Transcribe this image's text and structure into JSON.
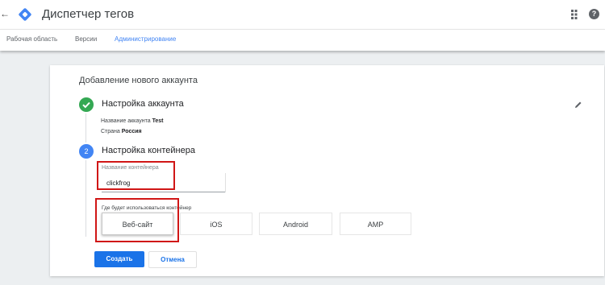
{
  "app": {
    "title": "Диспетчер тегов"
  },
  "nav": {
    "tabs": [
      {
        "label": "Рабочая область",
        "active": false
      },
      {
        "label": "Версии",
        "active": false
      },
      {
        "label": "Администрирование",
        "active": true
      }
    ]
  },
  "page": {
    "title": "Добавление нового аккаунта"
  },
  "step1": {
    "title": "Настройка аккаунта",
    "account_name_label": "Название аккаунта",
    "account_name_value": "Test",
    "country_label": "Страна",
    "country_value": "Россия"
  },
  "step2": {
    "number": "2",
    "title": "Настройка контейнера",
    "container_name_label": "Название контейнера",
    "container_name_value": "clickfrog",
    "target_label": "Где будет использоваться контейнер",
    "target_options": [
      {
        "label": "Веб-сайт",
        "selected": true
      },
      {
        "label": "iOS",
        "selected": false
      },
      {
        "label": "Android",
        "selected": false
      },
      {
        "label": "AMP",
        "selected": false
      }
    ]
  },
  "actions": {
    "create_label": "Создать",
    "cancel_label": "Отмена"
  },
  "colors": {
    "accent_blue": "#1a73e8",
    "success_green": "#34a853",
    "highlight_red": "#d01616"
  }
}
